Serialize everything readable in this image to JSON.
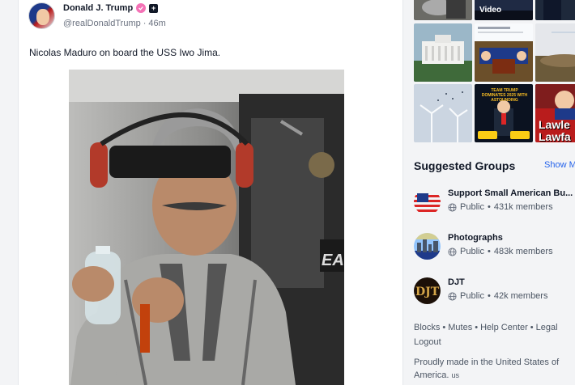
{
  "post": {
    "author_name": "Donald J. Trump",
    "handle": "@realDonaldTrump",
    "separator": "·",
    "time_ago": "46m",
    "text": "Nicolas Maduro on board the USS Iwo Jima.",
    "plus_badge": "+"
  },
  "media_grid": {
    "video_label": "Video",
    "lawless_text": [
      "Lawle",
      "Lawfa"
    ],
    "headline_text": "TEAM TRUMP DOMINATES 2025 WITH ASTOUNDING"
  },
  "suggested_groups": {
    "title": "Suggested Groups",
    "show_more": "Show M",
    "items": [
      {
        "name": "Support Small American Bu...",
        "visibility": "Public",
        "members": "431k members"
      },
      {
        "name": "Photographs",
        "visibility": "Public",
        "members": "483k members"
      },
      {
        "name": "DJT",
        "visibility": "Public",
        "members": "42k members"
      }
    ]
  },
  "footer": {
    "links": [
      "Blocks",
      "Mutes",
      "Help Center",
      "Legal",
      "Logout"
    ],
    "credit": "Proudly made in the United States of America.",
    "credit_suffix": "us"
  },
  "colors": {
    "link": "#2563eb",
    "verified": "#f472b6",
    "text_primary": "#111827",
    "text_secondary": "#4b5563"
  }
}
